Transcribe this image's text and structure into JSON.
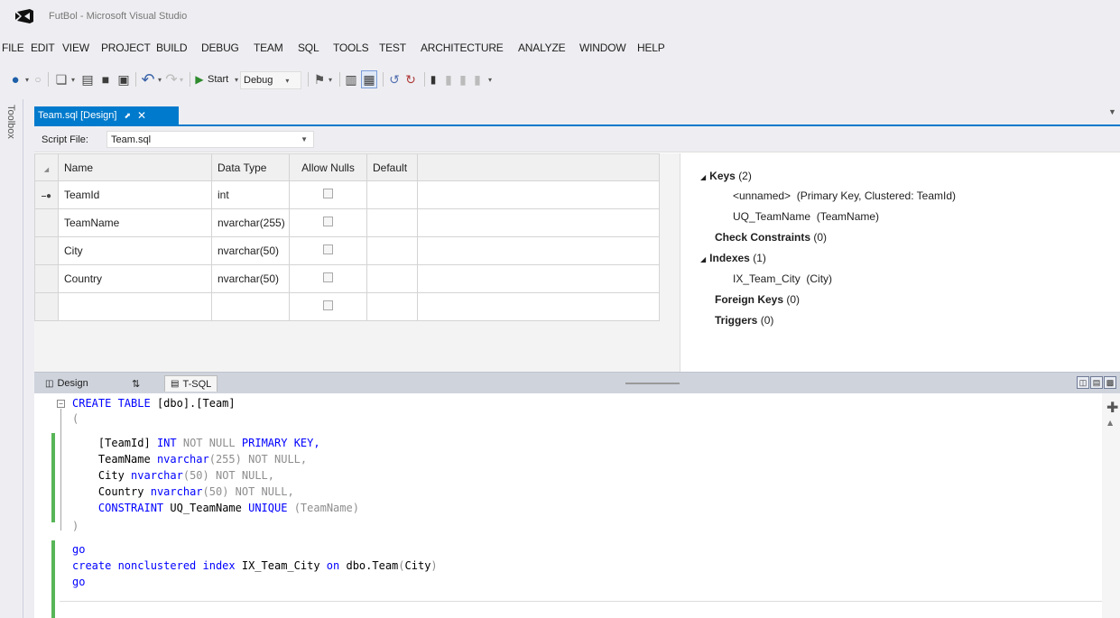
{
  "window": {
    "title": "FutBol - Microsoft Visual Studio"
  },
  "menu": [
    "FILE",
    "EDIT",
    "VIEW",
    "PROJECT",
    "BUILD",
    "DEBUG",
    "TEAM",
    "SQL",
    "TOOLS",
    "TEST",
    "ARCHITECTURE",
    "ANALYZE",
    "WINDOW",
    "HELP"
  ],
  "toolbar": {
    "start_label": "Start",
    "config_value": "Debug"
  },
  "toolbox": {
    "label": "Toolbox"
  },
  "doc_tab": {
    "label": "Team.sql [Design]"
  },
  "script_file": {
    "label": "Script File:",
    "value": "Team.sql"
  },
  "columns_table": {
    "headers": [
      "Name",
      "Data Type",
      "Allow Nulls",
      "Default"
    ],
    "rows": [
      {
        "name": "TeamId",
        "type": "int",
        "allow_nulls": false,
        "primary_key": true
      },
      {
        "name": "TeamName",
        "type": "nvarchar(255)",
        "allow_nulls": false,
        "primary_key": false
      },
      {
        "name": "City",
        "type": "nvarchar(50)",
        "allow_nulls": false,
        "primary_key": false
      },
      {
        "name": "Country",
        "type": "nvarchar(50)",
        "allow_nulls": false,
        "primary_key": false
      },
      {
        "name": "",
        "type": "",
        "allow_nulls": false,
        "primary_key": false
      }
    ]
  },
  "properties": {
    "keys": {
      "label": "Keys",
      "count": "(2)"
    },
    "key_items": [
      {
        "name": "<unnamed>",
        "detail": "(Primary Key, Clustered: TeamId)"
      },
      {
        "name": "UQ_TeamName",
        "detail": "(TeamName)"
      }
    ],
    "check_constraints": {
      "label": "Check Constraints",
      "count": "(0)"
    },
    "indexes": {
      "label": "Indexes",
      "count": "(1)"
    },
    "index_items": [
      {
        "name": "IX_Team_City",
        "detail": "(City)"
      }
    ],
    "foreign_keys": {
      "label": "Foreign Keys",
      "count": "(0)"
    },
    "triggers": {
      "label": "Triggers",
      "count": "(0)"
    }
  },
  "split_tabs": {
    "design": "Design",
    "tsql": "T-SQL"
  },
  "code": {
    "create": "CREATE TABLE",
    "table_name": "[dbo].[Team]",
    "open_paren": "(",
    "close_paren": ")",
    "col1_name": "[TeamId]",
    "col1_type": "INT",
    "col1_null": "NOT NULL",
    "col1_pk": "PRIMARY KEY,",
    "col2_name": "TeamName",
    "col2_type": "nvarchar",
    "col2_size": "(255)",
    "col2_null": "NOT NULL,",
    "col3_name": "City",
    "col3_type": "nvarchar",
    "col3_size": "(50)",
    "col3_null": "NOT NULL,",
    "col4_name": "Country",
    "col4_type": "nvarchar",
    "col4_size": "(50)",
    "col4_null": "NOT NULL,",
    "constraint_kw": "CONSTRAINT",
    "constraint_name": "UQ_TeamName",
    "unique_kw": "UNIQUE",
    "constraint_cols": "(TeamName)",
    "go1": "go",
    "index_kw": "create nonclustered index",
    "index_name": "IX_Team_City",
    "on_kw": "on",
    "index_target": "dbo.Team",
    "index_paren_open": "(",
    "index_col": "City",
    "index_paren_close": ")",
    "go2": "go"
  },
  "colors": {
    "accent": "#007acc",
    "changed_line": "#57b557",
    "keyword": "#0000ff",
    "comment_gray": "#8e8e8e",
    "function": "#ff00ff"
  }
}
